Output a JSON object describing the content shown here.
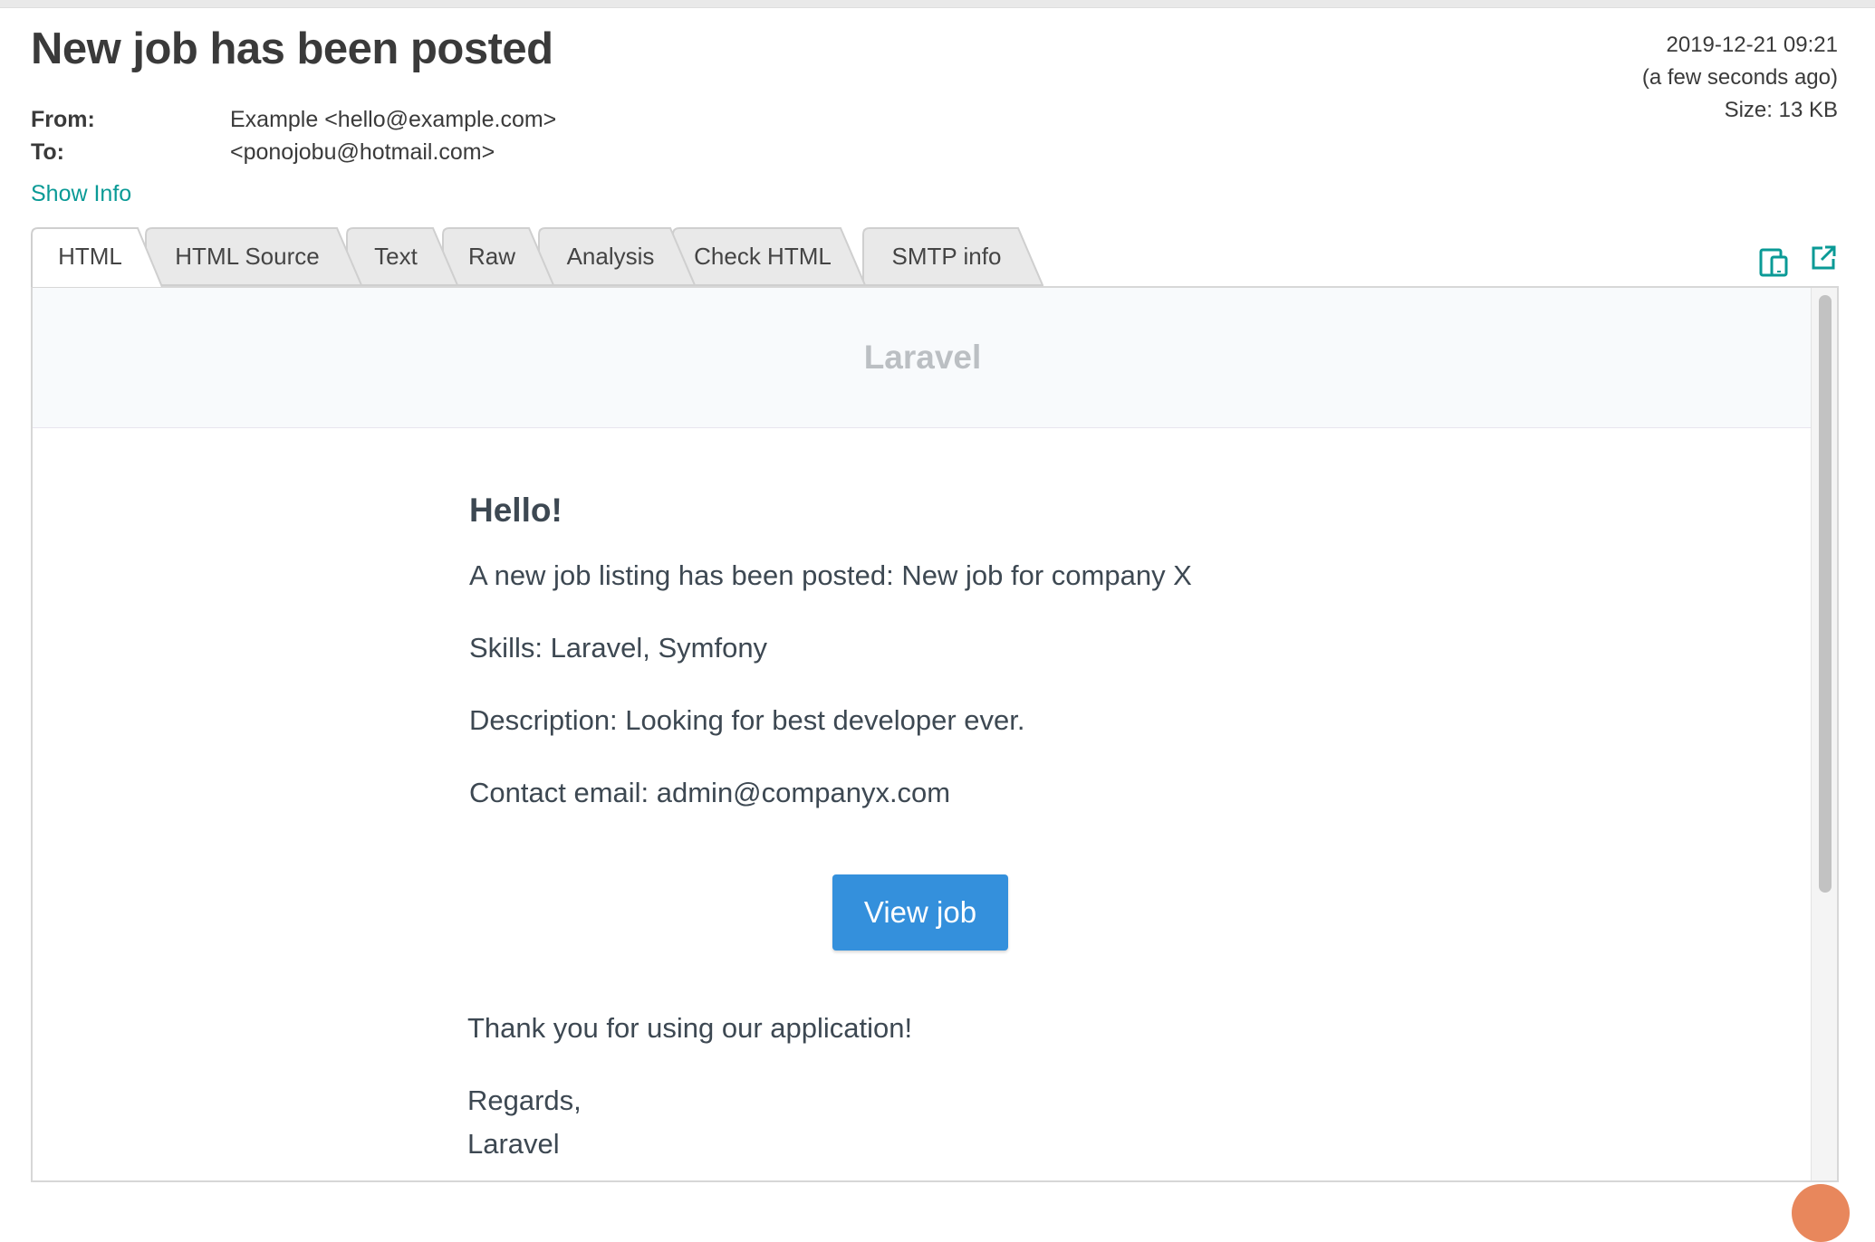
{
  "message": {
    "subject": "New job has been posted",
    "date": "2019-12-21 09:21",
    "relative_time": "(a few seconds ago)",
    "size": "Size: 13 KB",
    "from_label": "From:",
    "from_value": "Example <hello@example.com>",
    "to_label": "To:",
    "to_value": "<ponojobu@hotmail.com>",
    "show_info": "Show Info"
  },
  "tabs": [
    {
      "label": "HTML",
      "active": true
    },
    {
      "label": "HTML Source",
      "active": false
    },
    {
      "label": "Text",
      "active": false
    },
    {
      "label": "Raw",
      "active": false
    },
    {
      "label": "Analysis",
      "active": false
    },
    {
      "label": "Check HTML",
      "active": false
    },
    {
      "label": "SMTP info",
      "active": false
    }
  ],
  "tab_icons": {
    "responsive": "responsive-view-icon",
    "open_new": "open-new-window-icon"
  },
  "email": {
    "brand": "Laravel",
    "greeting": "Hello!",
    "lines": [
      "A new job listing has been posted: New job for company X",
      "Skills: Laravel, Symfony",
      "Description: Looking for best developer ever.",
      "Contact email: admin@companyx.com"
    ],
    "button_label": "View job",
    "thanks": "Thank you for using our application!",
    "regards": "Regards,",
    "signature": "Laravel"
  },
  "colors": {
    "accent": "#0a9a96",
    "button": "#3490dc",
    "brand_text": "#bbbfc3"
  }
}
